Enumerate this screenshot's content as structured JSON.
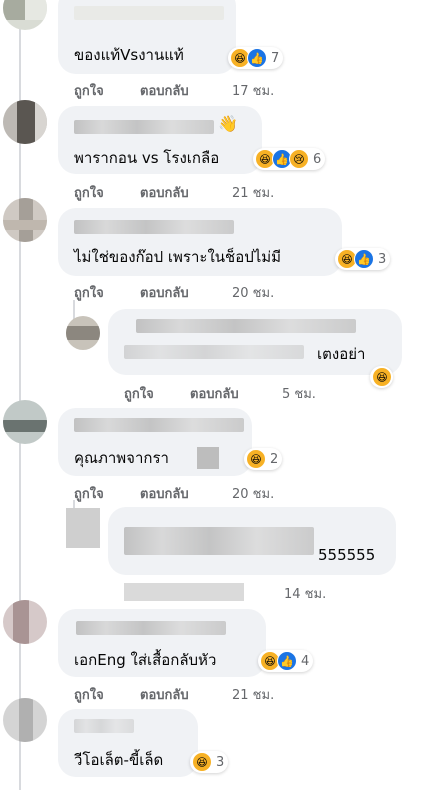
{
  "comments": [
    {
      "text": "ของแท้Vsงานแท้",
      "like": "ถูกใจ",
      "reply": "ตอบกลับ",
      "time": "17 ชม.",
      "reactions": [
        "haha",
        "like"
      ],
      "count": "7"
    },
    {
      "text": "พารากอน vs โรงเกลือ",
      "like": "ถูกใจ",
      "reply": "ตอบกลับ",
      "time": "21 ชม.",
      "reactions": [
        "haha",
        "like",
        "sad"
      ],
      "count": "6"
    },
    {
      "text": "ไม่ใช่ของก๊อป เพราะในช็อปไม่มี",
      "like": "ถูกใจ",
      "reply": "ตอบกลับ",
      "time": "20 ชม.",
      "reactions": [
        "haha",
        "like"
      ],
      "count": "3"
    },
    {
      "text": "เตงอย่า",
      "like": "ถูกใจ",
      "reply": "ตอบกลับ",
      "time": "5 ชม.",
      "reactions": [
        "haha"
      ],
      "count": ""
    },
    {
      "text": "คุณภาพจากรา",
      "like": "ถูกใจ",
      "reply": "ตอบกลับ",
      "time": "20 ชม.",
      "reactions": [
        "haha"
      ],
      "count": "2"
    },
    {
      "text": "555555",
      "like": "",
      "reply": "",
      "time": "14 ชม.",
      "reactions": [],
      "count": ""
    },
    {
      "text": "เอกEng ใส่เสื้อกลับหัว",
      "like": "ถูกใจ",
      "reply": "ตอบกลับ",
      "time": "21 ชม.",
      "reactions": [
        "haha",
        "like"
      ],
      "count": "4"
    },
    {
      "text": "วีโอเล็ต-ขี้เล็ด",
      "like": "",
      "reply": "",
      "time": "",
      "reactions": [
        "haha"
      ],
      "count": "3"
    }
  ],
  "colors": {
    "bubble": "#f0f2f5",
    "meta": "#65676b",
    "like_blue": "#1b74e4",
    "haha_yellow": "#f7b125"
  },
  "icons": {
    "haha": "haha-reaction-icon",
    "like": "like-reaction-icon",
    "sad": "sad-reaction-icon",
    "wave": "waving-hand-icon"
  }
}
